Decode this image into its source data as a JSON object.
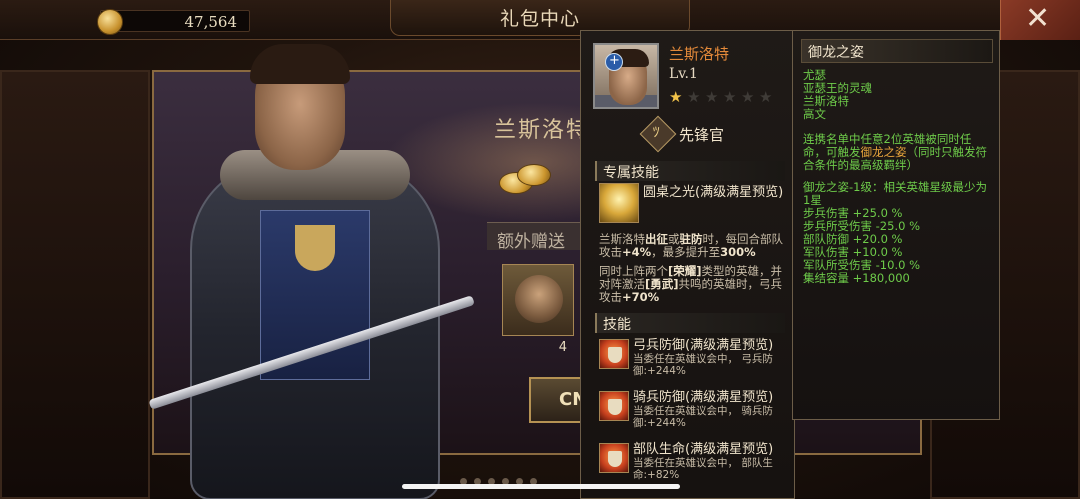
{
  "topbar": {
    "coins": "47,564",
    "title": "礼包中心",
    "close_glyph": "✕"
  },
  "bundle": {
    "hero_name": "兰斯洛特",
    "bonus_label": "额外赠送",
    "reward_count": "4",
    "buy_label": "CN",
    "page_dot_count": 6
  },
  "hero_panel": {
    "name": "兰斯洛特",
    "level": "Lv.1",
    "stars_filled": 1,
    "stars_total": 6,
    "class_glyph": "+",
    "role_glyph": "ﾂ",
    "role": "先锋官",
    "exclusive_header": "专属技能",
    "exclusive_skill": {
      "title": "圆桌之光(满级满星预览)",
      "desc1_a": "兰斯洛特",
      "desc1_b": "出征",
      "desc1_c": "或",
      "desc1_d": "驻防",
      "desc1_e": "时，每回合部队攻击",
      "desc1_f": "+4%",
      "desc1_g": "，最多提升至",
      "desc1_h": "300%",
      "desc2_a": "同时上阵两个",
      "desc2_b": "[荣耀]",
      "desc2_c": "类型的英雄，并对阵激活",
      "desc2_d": "[勇武]",
      "desc2_e": "共鸣的英雄时，弓兵攻击",
      "desc2_f": "+70%"
    },
    "skills_header": "技能",
    "skills": [
      {
        "title": "弓兵防御(满级满星预览)",
        "desc": "当委任在英雄议会中， 弓兵防御:+244%"
      },
      {
        "title": "骑兵防御(满级满星预览)",
        "desc": "当委任在英雄议会中， 骑兵防御:+244%"
      },
      {
        "title": "部队生命(满级满星预览)",
        "desc": "当委任在英雄议会中， 部队生命:+82%"
      }
    ]
  },
  "bond_panel": {
    "title": "御龙之姿",
    "heroes": [
      "尤瑟",
      "亚瑟王的灵魂",
      "兰斯洛特",
      "高文"
    ],
    "desc_a": "连携名单中任意2位英雄被同时任命，可触发",
    "desc_b": "御龙之姿",
    "desc_c": "（同时只触发符合条件的最高级羁绊）",
    "level_desc": "御龙之姿-1级：相关英雄星级最少为1星",
    "stats": [
      "步兵伤害 +25.0 %",
      "步兵所受伤害 -25.0 %",
      "部队防御 +20.0 %",
      "军队伤害 +10.0 %",
      "军队所受伤害 -10.0 %",
      "集结容量 +180,000"
    ]
  },
  "colors": {
    "hero_name": "#e48a3a",
    "bond_green": "#6ecb4a",
    "highlight_orange": "#e8a53c",
    "star_gold": "#f2c34a"
  },
  "icons": {
    "coin": "gold-coin-icon",
    "close": "close-icon",
    "class": "infantry-class-icon",
    "role": "vanguard-icon",
    "exclusive_skill": "round-table-light-icon",
    "skill": "shield-skill-icon"
  }
}
